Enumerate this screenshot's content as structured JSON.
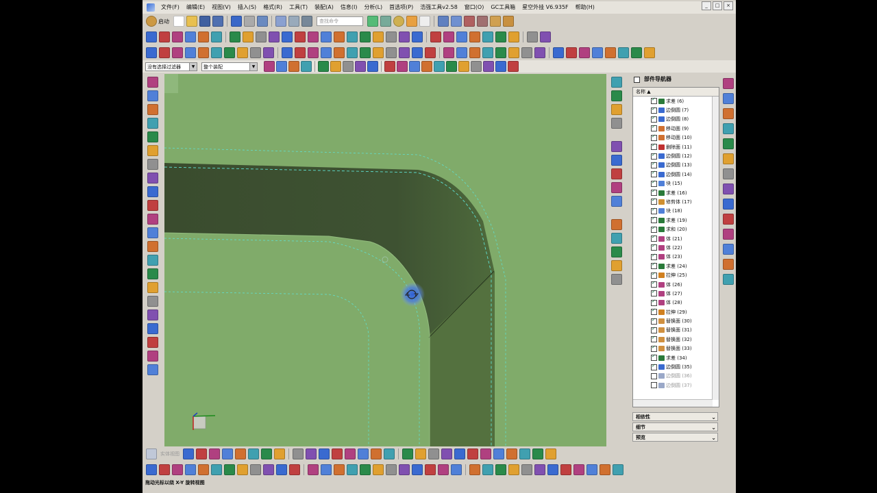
{
  "menu": [
    "文件(F)",
    "编辑(E)",
    "视图(V)",
    "插入(S)",
    "格式(R)",
    "工具(T)",
    "装配(A)",
    "信息(I)",
    "分析(L)",
    "首选项(P)",
    "浩强工具v2.58",
    "窗口(O)",
    "GC工具箱",
    "星空外挂 V6.935F",
    "帮助(H)"
  ],
  "toolbar": {
    "start_label": "启动",
    "search_placeholder": "查找命令",
    "filter_label": "没有选择过滤器",
    "assembly_label": "整个装配",
    "bottom_hint": "实体视图"
  },
  "navigator": {
    "title": "部件导航器",
    "column_header": "名称",
    "rows": [
      {
        "label": "求差 (6)",
        "on": true,
        "color": "#2a7a3a"
      },
      {
        "label": "边倒圆 (7)",
        "on": true,
        "color": "#3a6ad0"
      },
      {
        "label": "边倒圆 (8)",
        "on": true,
        "color": "#3a6ad0"
      },
      {
        "label": "移动面 (9)",
        "on": true,
        "color": "#d07030"
      },
      {
        "label": "移动面 (10)",
        "on": true,
        "color": "#d07030"
      },
      {
        "label": "删除面 (11)",
        "on": true,
        "color": "#c03030"
      },
      {
        "label": "边倒圆 (12)",
        "on": true,
        "color": "#3a6ad0"
      },
      {
        "label": "边倒圆 (13)",
        "on": true,
        "color": "#3a6ad0"
      },
      {
        "label": "边倒圆 (14)",
        "on": true,
        "color": "#3a6ad0"
      },
      {
        "label": "块 (15)",
        "on": true,
        "color": "#5080d8"
      },
      {
        "label": "求差 (16)",
        "on": true,
        "color": "#2a7a3a"
      },
      {
        "label": "修剪体 (17)",
        "on": true,
        "color": "#d09030"
      },
      {
        "label": "块 (18)",
        "on": true,
        "color": "#5080d8"
      },
      {
        "label": "求差 (19)",
        "on": true,
        "color": "#2a7a3a"
      },
      {
        "label": "求和 (20)",
        "on": true,
        "color": "#2a7a3a"
      },
      {
        "label": "体 (21)",
        "on": true,
        "color": "#b04080"
      },
      {
        "label": "体 (22)",
        "on": true,
        "color": "#b04080"
      },
      {
        "label": "体 (23)",
        "on": true,
        "color": "#b04080"
      },
      {
        "label": "求差 (24)",
        "on": true,
        "color": "#2a7a3a"
      },
      {
        "label": "拉伸 (25)",
        "on": true,
        "color": "#d08020"
      },
      {
        "label": "体 (26)",
        "on": true,
        "color": "#b04080"
      },
      {
        "label": "体 (27)",
        "on": true,
        "color": "#b04080"
      },
      {
        "label": "体 (28)",
        "on": true,
        "color": "#b04080"
      },
      {
        "label": "拉伸 (29)",
        "on": true,
        "color": "#d08020"
      },
      {
        "label": "替换面 (30)",
        "on": true,
        "color": "#d09040"
      },
      {
        "label": "替换面 (31)",
        "on": true,
        "color": "#d09040"
      },
      {
        "label": "替换面 (32)",
        "on": true,
        "color": "#d09040"
      },
      {
        "label": "替换面 (33)",
        "on": true,
        "color": "#d09040"
      },
      {
        "label": "求差 (34)",
        "on": true,
        "color": "#2a7a3a"
      },
      {
        "label": "边倒圆 (35)",
        "on": true,
        "color": "#3a6ad0"
      },
      {
        "label": "边倒圆 (36)",
        "on": false,
        "color": "#9aa8c8"
      },
      {
        "label": "边倒圆 (37)",
        "on": false,
        "color": "#9aa8c8"
      }
    ],
    "sections": [
      "相依性",
      "细节",
      "预览"
    ]
  },
  "status": "拖动光标以绕 X-Y 旋转视图",
  "colors": {
    "viewport": "#80ab6a",
    "solid_dark": "#3e5232",
    "solid_mid": "#54713f",
    "edge_dashed": "#5fe0d0",
    "highlight": "#2f5fd8"
  }
}
